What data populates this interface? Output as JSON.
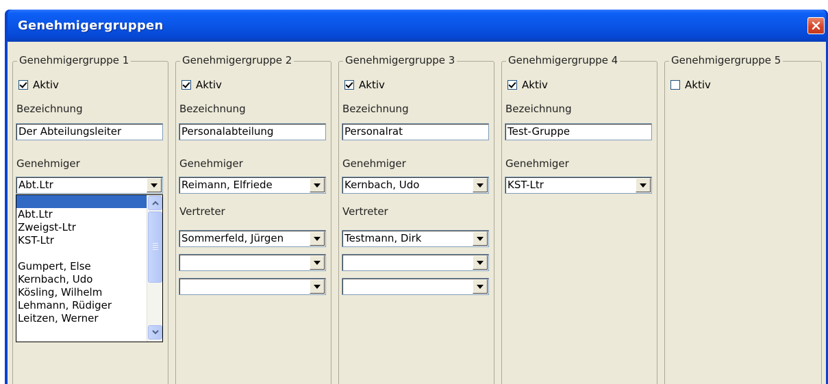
{
  "window": {
    "title": "Genehmigergruppen"
  },
  "groups": [
    {
      "title": "Genehmigergruppe 1",
      "aktiv_label": "Aktiv",
      "aktiv": true,
      "bezeichnung_label": "Bezeichnung",
      "bezeichnung": "Der Abteilungsleiter",
      "genehmiger_label": "Genehmiger",
      "genehmiger": "Abt.Ltr"
    },
    {
      "title": "Genehmigergruppe 2",
      "aktiv_label": "Aktiv",
      "aktiv": true,
      "bezeichnung_label": "Bezeichnung",
      "bezeichnung": "Personalabteilung",
      "genehmiger_label": "Genehmiger",
      "genehmiger": "Reimann, Elfriede",
      "vertreter_label": "Vertreter",
      "vertreter": [
        "Sommerfeld, Jürgen",
        "",
        ""
      ]
    },
    {
      "title": "Genehmigergruppe 3",
      "aktiv_label": "Aktiv",
      "aktiv": true,
      "bezeichnung_label": "Bezeichnung",
      "bezeichnung": "Personalrat",
      "genehmiger_label": "Genehmiger",
      "genehmiger": "Kernbach, Udo",
      "vertreter_label": "Vertreter",
      "vertreter": [
        "Testmann, Dirk",
        "",
        ""
      ]
    },
    {
      "title": "Genehmigergruppe 4",
      "aktiv_label": "Aktiv",
      "aktiv": true,
      "bezeichnung_label": "Bezeichnung",
      "bezeichnung": "Test-Gruppe",
      "genehmiger_label": "Genehmiger",
      "genehmiger": "KST-Ltr"
    },
    {
      "title": "Genehmigergruppe 5",
      "aktiv_label": "Aktiv",
      "aktiv": false
    }
  ],
  "dropdown_items": [
    "",
    "Abt.Ltr",
    "Zweigst-Ltr",
    "KST-Ltr",
    "",
    "Gumpert, Else",
    "Kernbach, Udo",
    "Kösling, Wilhelm",
    "Lehmann, Rüdiger",
    "Leitzen, Werner"
  ]
}
